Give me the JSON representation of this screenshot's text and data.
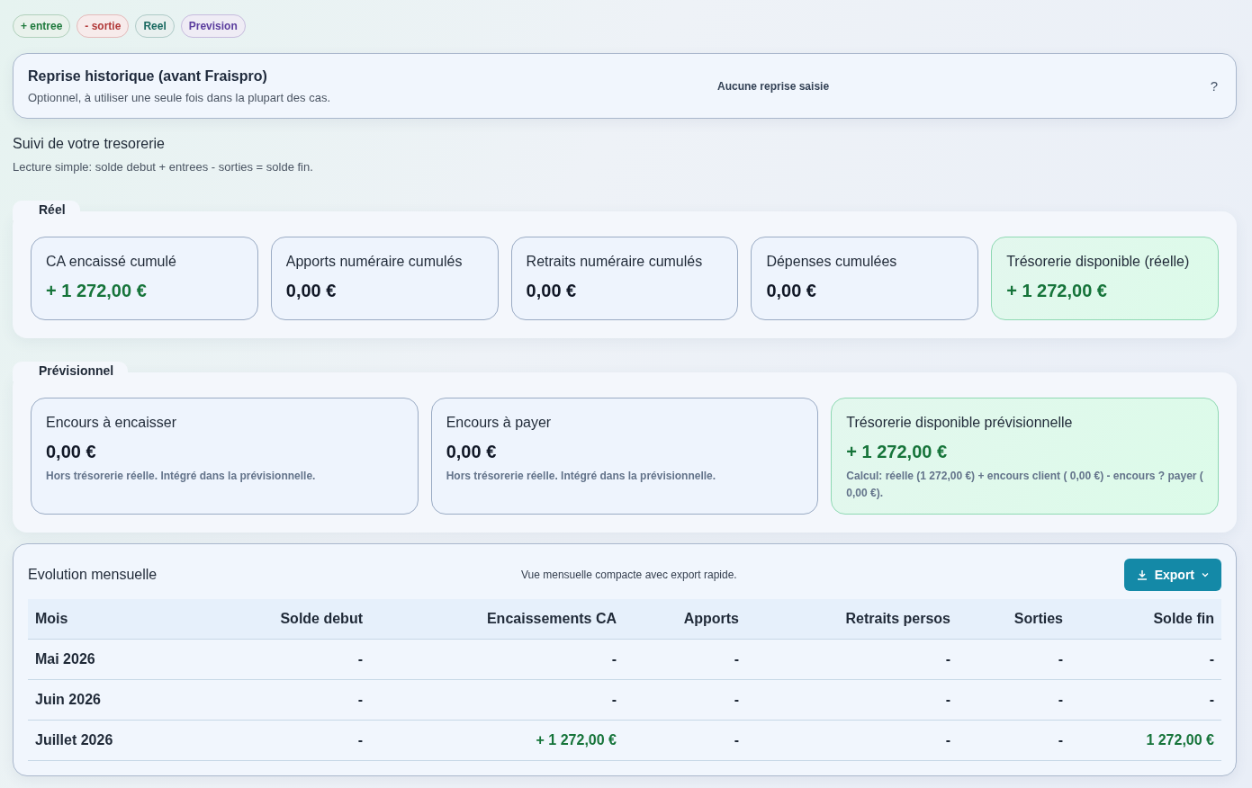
{
  "legend_chips": [
    {
      "label": "+ entree",
      "color": "#1e7a3c"
    },
    {
      "label": "- sortie",
      "color": "#b23a3a"
    },
    {
      "label": "Reel",
      "color": "#17685f"
    },
    {
      "label": "Prevision",
      "color": "#5b3d9e"
    }
  ],
  "reprise": {
    "title": "Reprise historique (avant Fraispro)",
    "subtitle": "Optionnel, à utiliser une seule fois dans la plupart des cas.",
    "status": "Aucune reprise saisie",
    "help": "?"
  },
  "tresorerie": {
    "title": "Suivi de votre tresorerie",
    "subtitle": "Lecture simple: solde debut + entrees - sorties = solde fin."
  },
  "sections": [
    {
      "legend": "Réel",
      "cards": [
        {
          "label": "CA encaissé cumulé",
          "value": "+ 1 272,00 €",
          "positive": true,
          "highlight": false
        },
        {
          "label": "Apports numéraire cumulés",
          "value": "0,00 €",
          "positive": false,
          "highlight": false
        },
        {
          "label": "Retraits numéraire cumulés",
          "value": "0,00 €",
          "positive": false,
          "highlight": false
        },
        {
          "label": "Dépenses cumulées",
          "value": "0,00 €",
          "positive": false,
          "highlight": false
        },
        {
          "label": "Trésorerie disponible (réelle)",
          "value": "+ 1 272,00 €",
          "positive": true,
          "highlight": true
        }
      ]
    },
    {
      "legend": "Prévisionnel",
      "cards": [
        {
          "label": "Encours à encaisser",
          "value": "0,00 €",
          "positive": false,
          "highlight": false,
          "note": "Hors trésorerie réelle. Intégré dans la prévisionnelle."
        },
        {
          "label": "Encours à payer",
          "value": "0,00 €",
          "positive": false,
          "highlight": false,
          "note": "Hors trésorerie réelle. Intégré dans la prévisionnelle."
        },
        {
          "label": "Trésorerie disponible prévisionnelle",
          "value": "+ 1 272,00 €",
          "positive": true,
          "highlight": true,
          "note": "Calcul: réelle (1 272,00 €) + encours client ( 0,00 €) - encours ? payer ( 0,00 €)."
        }
      ]
    }
  ],
  "evolution": {
    "title": "Evolution mensuelle",
    "subtitle": "Vue mensuelle compacte avec export rapide.",
    "export_button": "Export",
    "columns": [
      "Mois",
      "Solde debut",
      "Encaissements CA",
      "Apports",
      "Retraits persos",
      "Sorties",
      "Solde fin"
    ],
    "rows": [
      {
        "cells": [
          {
            "text": "Mai 2026",
            "positive": false
          },
          {
            "text": "-",
            "positive": false
          },
          {
            "text": "-",
            "positive": false
          },
          {
            "text": "-",
            "positive": false
          },
          {
            "text": "-",
            "positive": false
          },
          {
            "text": "-",
            "positive": false
          },
          {
            "text": "-",
            "positive": false
          }
        ]
      },
      {
        "cells": [
          {
            "text": "Juin 2026",
            "positive": false
          },
          {
            "text": "-",
            "positive": false
          },
          {
            "text": "-",
            "positive": false
          },
          {
            "text": "-",
            "positive": false
          },
          {
            "text": "-",
            "positive": false
          },
          {
            "text": "-",
            "positive": false
          },
          {
            "text": "-",
            "positive": false
          }
        ]
      },
      {
        "cells": [
          {
            "text": "Juillet 2026",
            "positive": false
          },
          {
            "text": "-",
            "positive": false
          },
          {
            "text": "+ 1 272,00 €",
            "positive": true
          },
          {
            "text": "-",
            "positive": false
          },
          {
            "text": "-",
            "positive": false
          },
          {
            "text": "-",
            "positive": false
          },
          {
            "text": "1 272,00 €",
            "positive": true
          }
        ]
      }
    ]
  }
}
